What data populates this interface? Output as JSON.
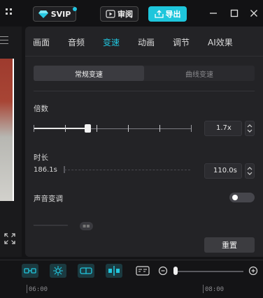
{
  "topbar": {
    "svip_label": "SVIP",
    "review_label": "审阅",
    "export_label": "导出"
  },
  "panel": {
    "tabs": [
      {
        "label": "画面"
      },
      {
        "label": "音频"
      },
      {
        "label": "变速",
        "active": true
      },
      {
        "label": "动画"
      },
      {
        "label": "调节"
      },
      {
        "label": "AI效果"
      }
    ],
    "modes": [
      {
        "label": "常规变速",
        "active": true
      },
      {
        "label": "曲线变速"
      }
    ],
    "speed": {
      "label": "倍数",
      "value": "1.7x",
      "slider_level": 0.34
    },
    "duration": {
      "label": "时长",
      "original": "186.1s",
      "value": "110.0s"
    },
    "pitch": {
      "label": "声音变调",
      "enabled": false
    },
    "reset_label": "重置"
  },
  "timeline": {
    "ticks": [
      "06:00",
      "08:00"
    ]
  },
  "colors": {
    "accent": "#21c4dd",
    "export_bg": "#1ec6dc",
    "panel_bg": "#232326"
  }
}
